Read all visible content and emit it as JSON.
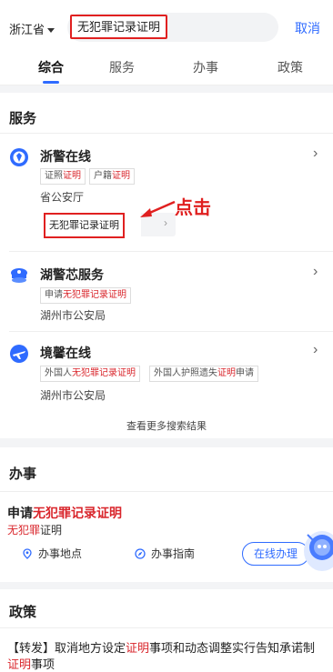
{
  "search": {
    "region": "浙江省",
    "query": "无犯罪记录证明",
    "cancel_label": "取消"
  },
  "tabs": [
    {
      "label": "综合",
      "active": true
    },
    {
      "label": "服务",
      "active": false
    },
    {
      "label": "办事",
      "active": false
    },
    {
      "label": "政策",
      "active": false
    }
  ],
  "services": {
    "title": "服务",
    "items": [
      {
        "name": "浙警在线",
        "icon": "police-badge-icon",
        "tags": [
          [
            "证照",
            "证明"
          ],
          [
            "户籍",
            "证明"
          ]
        ],
        "org": "省公安厅",
        "selected_tag": "无犯罪记录证明"
      },
      {
        "name": "湖警芯服务",
        "icon": "police-cap-icon",
        "tags": [
          [
            "申请",
            "无犯罪记录证明"
          ]
        ],
        "org": "湖州市公安局"
      },
      {
        "name": "境馨在线",
        "icon": "airplane-icon",
        "tags": [
          [
            "外国人",
            "无犯罪记录证明"
          ],
          [
            "外国人护照遗失",
            "证明",
            "申请"
          ]
        ],
        "org": "湖州市公安局"
      }
    ],
    "more_results": "查看更多搜索结果",
    "annotation": "点击"
  },
  "banshi": {
    "title": "办事",
    "item": {
      "title_prefix": "申请",
      "title_highlight": "无犯罪记录证明",
      "sub_highlight": "无犯罪",
      "sub_rest": "证明"
    },
    "actions": {
      "location": "办事地点",
      "guide": "办事指南",
      "online": "在线办理"
    }
  },
  "policy": {
    "title": "政策",
    "line_1_a": "【转发】取消地方设定",
    "line_1_hl": "证明",
    "line_1_b": "事项和动态调整实行告知承诺",
    "line_2_a": "制",
    "line_2_hl": "证明",
    "line_2_b": "事项"
  },
  "colors": {
    "accent": "#2f6bff",
    "highlight": "#d9262c",
    "annotation": "#e02020"
  }
}
